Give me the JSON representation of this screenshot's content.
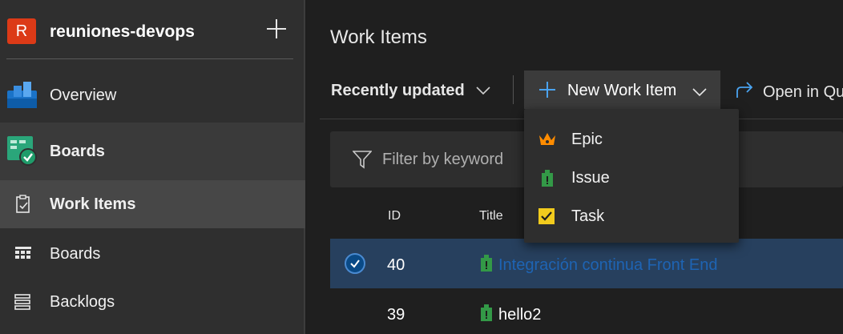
{
  "project": {
    "avatar_letter": "R",
    "name": "reuniones-devops"
  },
  "nav": {
    "overview": "Overview",
    "boards_hub": "Boards",
    "work_items": "Work Items",
    "boards": "Boards",
    "backlogs": "Backlogs"
  },
  "page": {
    "title": "Work Items"
  },
  "toolbar": {
    "pivot_label": "Recently updated",
    "new_work_item_label": "New Work Item",
    "open_query_label": "Open in Qu"
  },
  "filter": {
    "placeholder": "Filter by keyword"
  },
  "table": {
    "columns": {
      "id": "ID",
      "title": "Title"
    },
    "rows": [
      {
        "id": "40",
        "title": "Integración continua Front End",
        "type": "Issue",
        "selected": true
      },
      {
        "id": "39",
        "title": "hello2",
        "type": "Issue",
        "selected": false
      }
    ]
  },
  "menu": {
    "items": [
      {
        "label": "Epic",
        "icon": "crown-icon",
        "color": "#ff8c00"
      },
      {
        "label": "Issue",
        "icon": "issue-icon",
        "color": "#339947"
      },
      {
        "label": "Task",
        "icon": "task-checkbox-icon",
        "color": "#f2cb1d"
      }
    ]
  },
  "colors": {
    "accent": "#0078d4",
    "project_avatar": "#dc3a17",
    "selected_row": "#27405e",
    "selected_title": "#1e64b4"
  }
}
